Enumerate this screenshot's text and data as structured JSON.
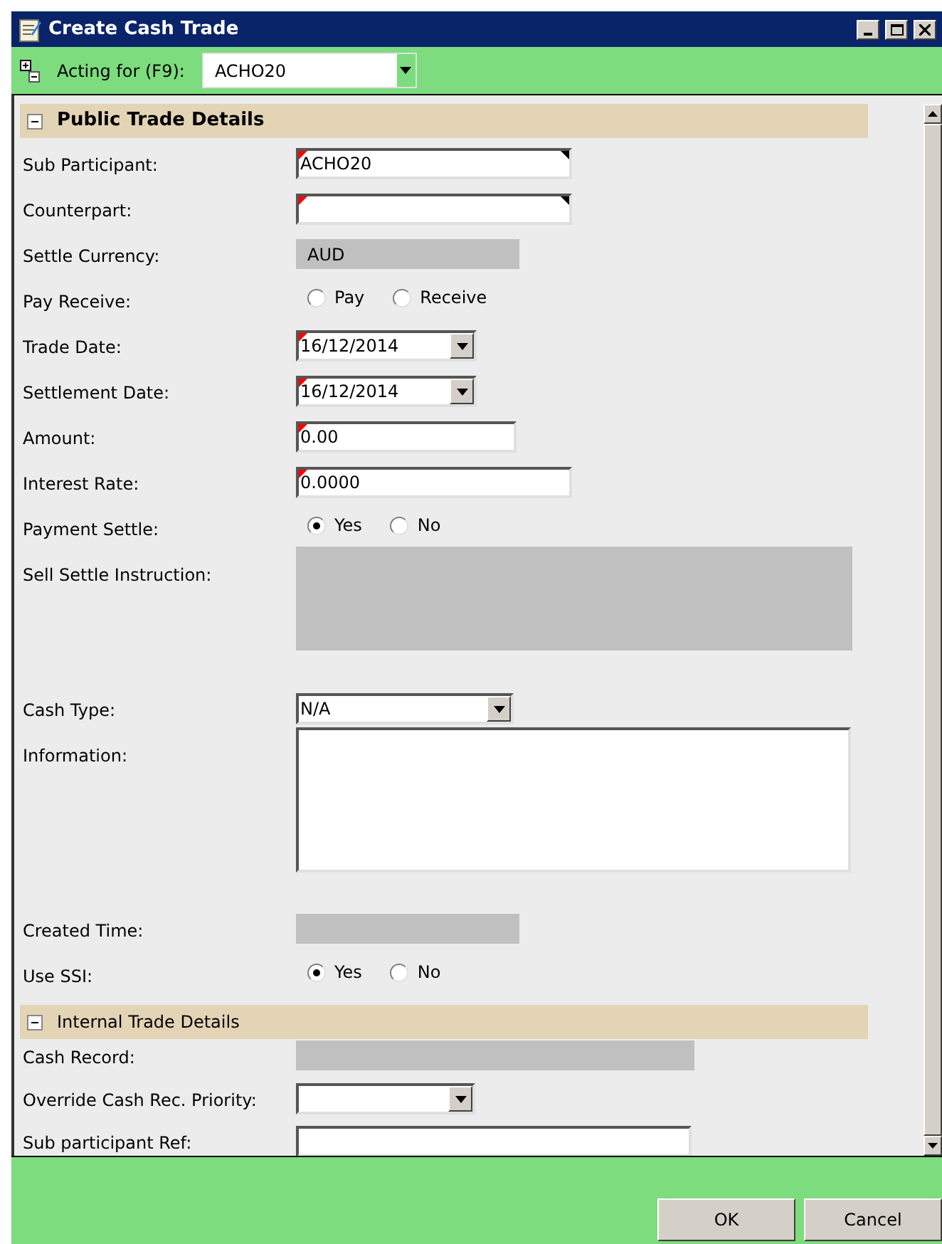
{
  "window": {
    "title": "Create Cash Trade"
  },
  "toolbar": {
    "label": "Acting for (F9):",
    "value": "ACHO20"
  },
  "sections": [
    {
      "title": "Public Trade Details",
      "bold": true,
      "expanded": true,
      "fields": [
        {
          "kind": "text",
          "label": "Sub Participant:",
          "value": "ACHO20",
          "required": true,
          "lookup": true
        },
        {
          "kind": "text",
          "label": "Counterpart:",
          "required": true,
          "lookup": true
        },
        {
          "kind": "readonly",
          "label": "Settle Currency:",
          "value": "AUD"
        },
        {
          "kind": "radio",
          "label": "Pay Receive:",
          "options": [
            {
              "label": "Pay",
              "selected": false
            },
            {
              "label": "Receive",
              "selected": false
            }
          ]
        },
        {
          "kind": "date",
          "label": "Trade Date:",
          "value": "16/12/2014",
          "required": true
        },
        {
          "kind": "date",
          "label": "Settlement Date:",
          "value": "16/12/2014",
          "required": true
        },
        {
          "kind": "text",
          "label": "Amount:",
          "value": "0.00",
          "required": true
        },
        {
          "kind": "text",
          "label": "Interest Rate:",
          "value": "0.0000",
          "required": true
        },
        {
          "kind": "radio",
          "label": "Payment Settle:",
          "options": [
            {
              "label": "Yes",
              "selected": true
            },
            {
              "label": "No",
              "selected": false
            }
          ]
        },
        {
          "kind": "readonly-box",
          "label": "Sell Settle Instruction:"
        },
        {
          "kind": "dropdown",
          "label": "Cash Type:",
          "value": "N/A"
        },
        {
          "kind": "textarea",
          "label": "Information:"
        },
        {
          "kind": "readonly",
          "label": "Created Time:"
        },
        {
          "kind": "radio",
          "label": "Use SSI:",
          "options": [
            {
              "label": "Yes",
              "selected": true
            },
            {
              "label": "No",
              "selected": false
            }
          ]
        }
      ]
    },
    {
      "title": "Internal Trade Details",
      "bold": false,
      "expanded": true,
      "fields": [
        {
          "kind": "readonly",
          "label": "Cash Record:"
        },
        {
          "kind": "dropdown",
          "label": "Override Cash Rec. Priority:"
        },
        {
          "kind": "text",
          "label": "Sub participant Ref:"
        }
      ]
    }
  ],
  "buttons": [
    "OK",
    "Cancel"
  ]
}
